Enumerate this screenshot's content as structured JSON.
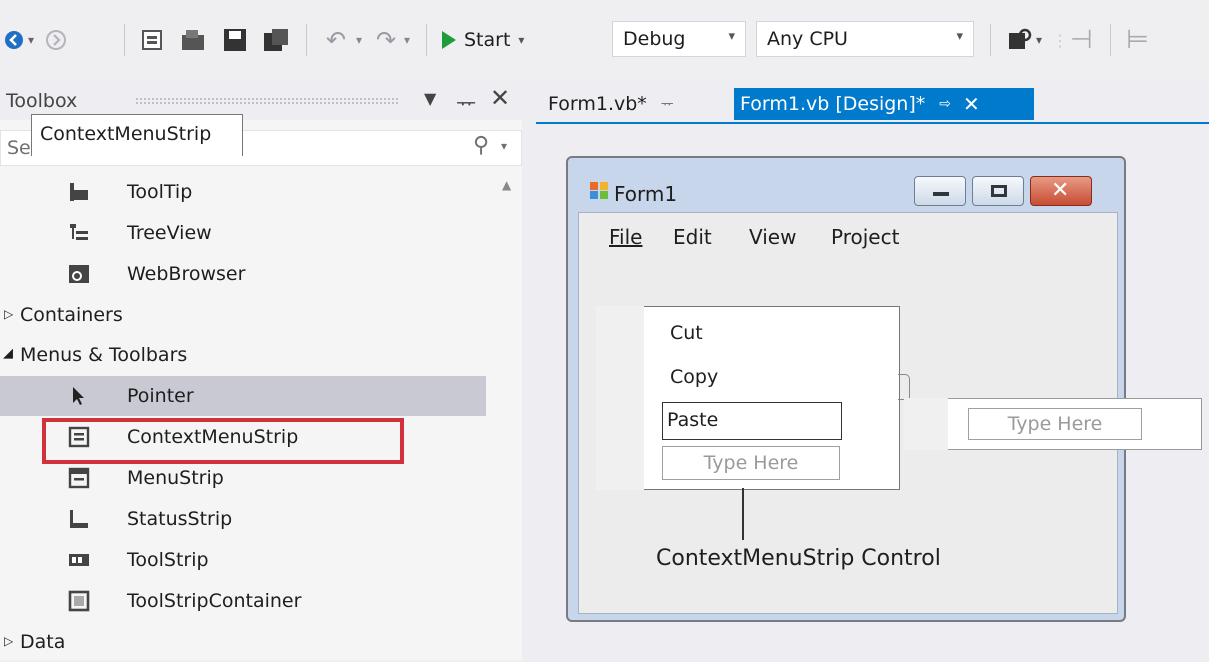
{
  "toolbar": {
    "start_label": "Start",
    "config_value": "Debug",
    "platform_value": "Any CPU"
  },
  "toolbox": {
    "title": "Toolbox",
    "search_placeholder": "Search Toolbox",
    "items": [
      {
        "label": "ToolTip",
        "icon": "tooltip-icon",
        "kind": "tool"
      },
      {
        "label": "TreeView",
        "icon": "treeview-icon",
        "kind": "tool"
      },
      {
        "label": "WebBrowser",
        "icon": "webbrowser-icon",
        "kind": "tool"
      },
      {
        "label": "Containers",
        "icon": "expand-arrow-icon",
        "kind": "category"
      },
      {
        "label": "Menus & Toolbars",
        "icon": "collapse-arrow-icon",
        "kind": "category"
      },
      {
        "label": "Pointer",
        "icon": "pointer-icon",
        "kind": "tool"
      },
      {
        "label": "ContextMenuStrip",
        "icon": "contextmenustrip-icon",
        "kind": "tool"
      },
      {
        "label": "MenuStrip",
        "icon": "menustrip-icon",
        "kind": "tool"
      },
      {
        "label": "StatusStrip",
        "icon": "statusstrip-icon",
        "kind": "tool"
      },
      {
        "label": "ToolStrip",
        "icon": "toolstrip-icon",
        "kind": "tool"
      },
      {
        "label": "ToolStripContainer",
        "icon": "toolstripcontainer-icon",
        "kind": "tool"
      },
      {
        "label": "Data",
        "icon": "expand-arrow-icon",
        "kind": "category"
      }
    ]
  },
  "tabs": {
    "code_tab": "Form1.vb*",
    "design_tab": "Form1.vb [Design]*"
  },
  "form": {
    "title": "Form1",
    "menu": [
      "File",
      "Edit",
      "View",
      "Project"
    ],
    "context_menu_tab": "ContextMenuStrip",
    "context_items": [
      "Cut",
      "Copy",
      "Paste"
    ],
    "type_here": "Type Here",
    "callout": "ContextMenuStrip Control"
  },
  "colors": {
    "accent": "#007acc",
    "highlight_box": "#d1313a"
  }
}
